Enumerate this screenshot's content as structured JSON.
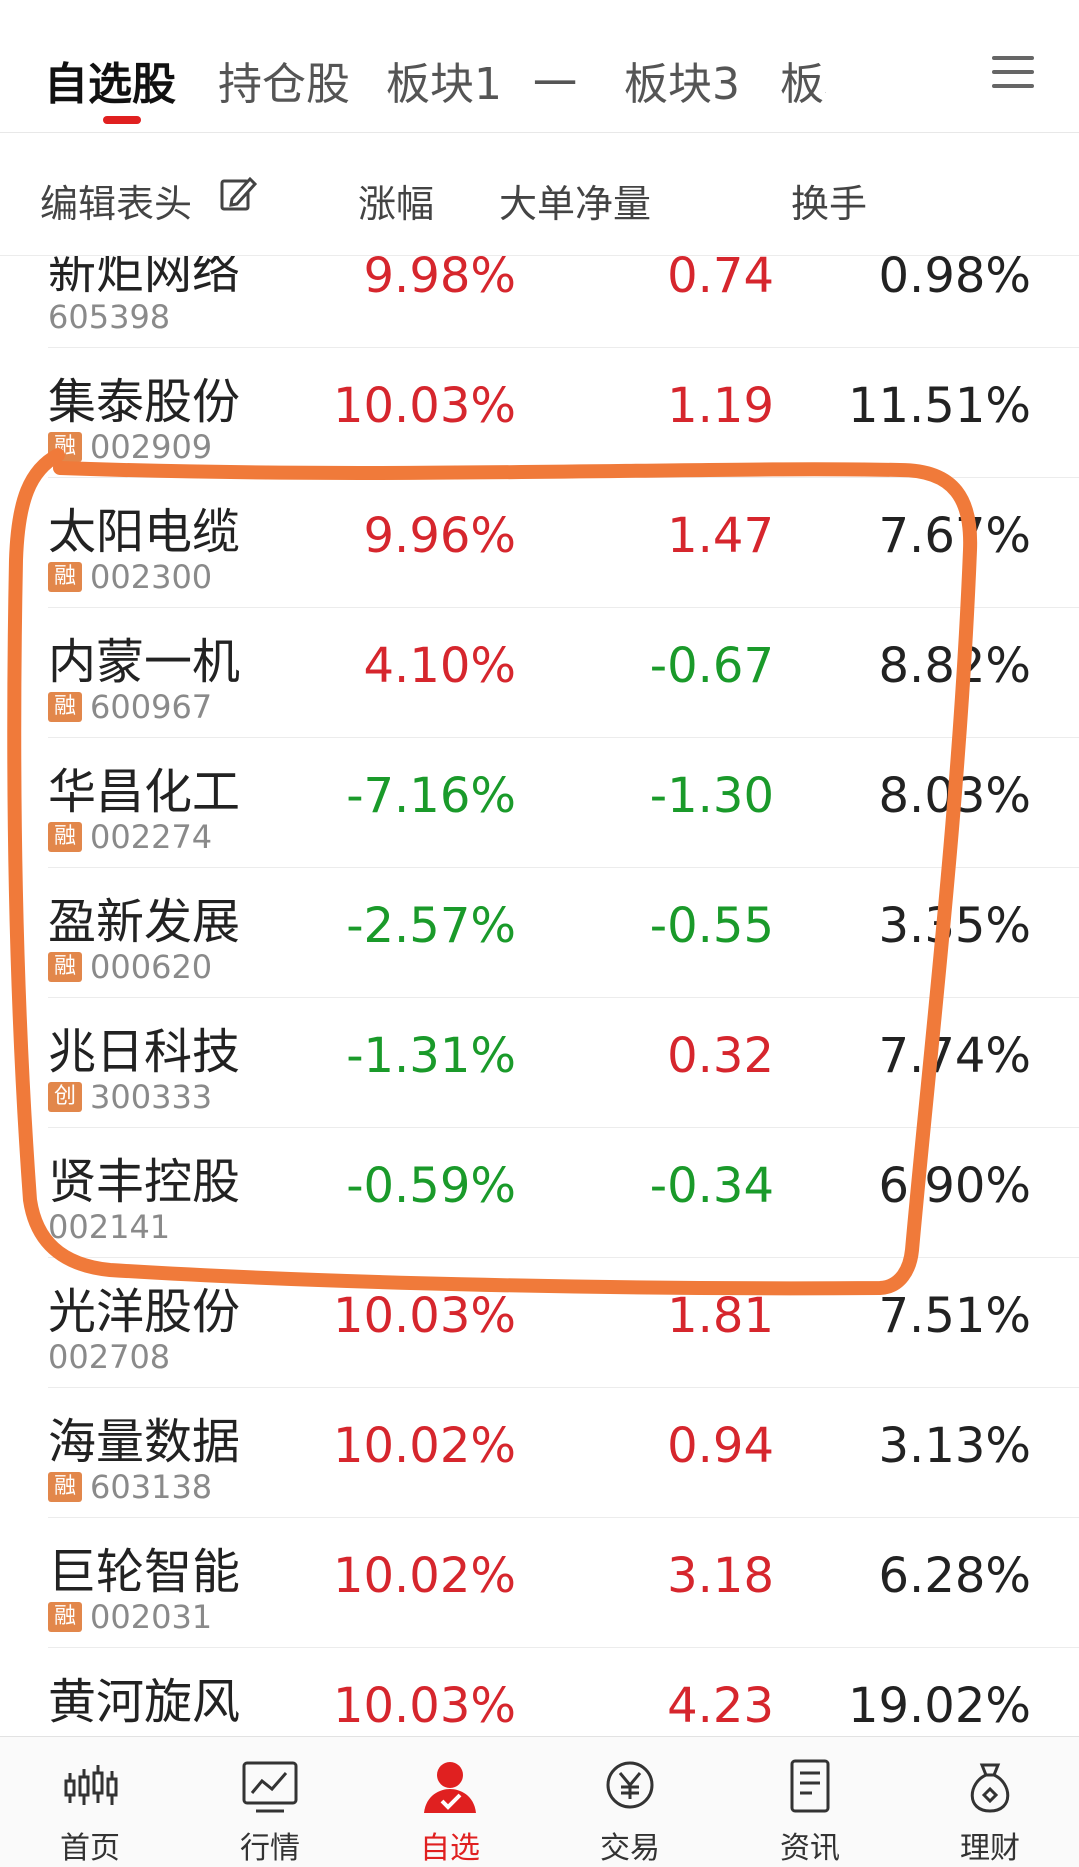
{
  "tabs": [
    {
      "label": "自选股",
      "active": true
    },
    {
      "label": "持仓股",
      "active": false
    },
    {
      "label": "板块1",
      "active": false
    },
    {
      "label": "一",
      "active": false
    },
    {
      "label": "板块3",
      "active": false
    },
    {
      "label": "板块",
      "active": false
    }
  ],
  "header": {
    "edit_label": "编辑表头",
    "col_change": "涨幅",
    "col_bigorder": "大单净量",
    "col_turnover": "换手"
  },
  "stocks": [
    {
      "name": "新炬网络",
      "code": "605398",
      "badge": "",
      "change": "9.98%",
      "bigorder": "0.74",
      "turnover": "0.98%"
    },
    {
      "name": "集泰股份",
      "code": "002909",
      "badge": "融",
      "change": "10.03%",
      "bigorder": "1.19",
      "turnover": "11.51%"
    },
    {
      "name": "太阳电缆",
      "code": "002300",
      "badge": "融",
      "change": "9.96%",
      "bigorder": "1.47",
      "turnover": "7.67%"
    },
    {
      "name": "内蒙一机",
      "code": "600967",
      "badge": "融",
      "change": "4.10%",
      "bigorder": "-0.67",
      "turnover": "8.82%"
    },
    {
      "name": "华昌化工",
      "code": "002274",
      "badge": "融",
      "change": "-7.16%",
      "bigorder": "-1.30",
      "turnover": "8.03%"
    },
    {
      "name": "盈新发展",
      "code": "000620",
      "badge": "融",
      "change": "-2.57%",
      "bigorder": "-0.55",
      "turnover": "3.35%"
    },
    {
      "name": "兆日科技",
      "code": "300333",
      "badge": "创",
      "change": "-1.31%",
      "bigorder": "0.32",
      "turnover": "7.74%"
    },
    {
      "name": "贤丰控股",
      "code": "002141",
      "badge": "",
      "change": "-0.59%",
      "bigorder": "-0.34",
      "turnover": "6.90%"
    },
    {
      "name": "光洋股份",
      "code": "002708",
      "badge": "",
      "change": "10.03%",
      "bigorder": "1.81",
      "turnover": "7.51%"
    },
    {
      "name": "海量数据",
      "code": "603138",
      "badge": "融",
      "change": "10.02%",
      "bigorder": "0.94",
      "turnover": "3.13%"
    },
    {
      "name": "巨轮智能",
      "code": "002031",
      "badge": "融",
      "change": "10.02%",
      "bigorder": "3.18",
      "turnover": "6.28%"
    },
    {
      "name": "黄河旋风",
      "code": "",
      "badge": "",
      "change": "10.03%",
      "bigorder": "4.23",
      "turnover": "19.02%"
    }
  ],
  "nav": [
    {
      "label": "首页",
      "icon": "candlestick-icon",
      "active": false
    },
    {
      "label": "行情",
      "icon": "market-chart-icon",
      "active": false
    },
    {
      "label": "自选",
      "icon": "watchlist-user-icon",
      "active": true
    },
    {
      "label": "交易",
      "icon": "yuan-coin-icon",
      "active": false
    },
    {
      "label": "资讯",
      "icon": "news-document-icon",
      "active": false
    },
    {
      "label": "理财",
      "icon": "money-bag-icon",
      "active": false
    }
  ],
  "colors": {
    "accent": "#e02020",
    "up": "#d6262d",
    "down": "#1a9a2a",
    "badge": "#e2874b",
    "annotation": "#f07a3a"
  }
}
